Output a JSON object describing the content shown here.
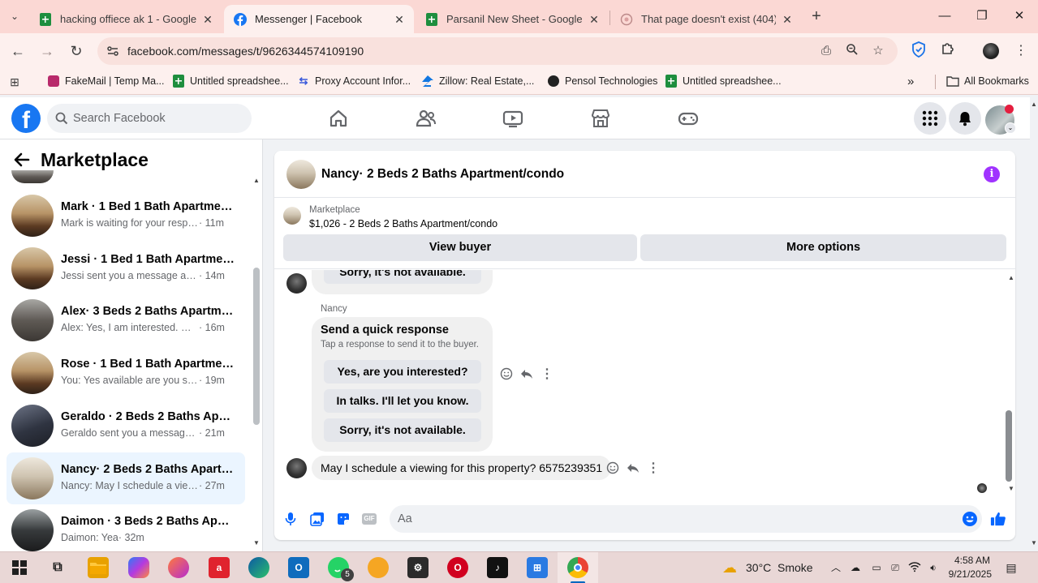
{
  "browser": {
    "tabs": [
      {
        "title": "hacking offiece ak 1 - Google Sh",
        "icon": "sheets-icon"
      },
      {
        "title": "Messenger | Facebook",
        "icon": "facebook-icon"
      },
      {
        "title": "Parsanil New Sheet - Google Sh",
        "icon": "sheets-icon"
      },
      {
        "title": "That page doesn't exist (404) - I",
        "icon": "globe-icon"
      }
    ],
    "active_tab": 1,
    "url": "facebook.com/messages/t/9626344574109190",
    "bookmarks": [
      {
        "label": "FakeMail | Temp Ma...",
        "icon": "fakemail-icon"
      },
      {
        "label": "Untitled spreadshee...",
        "icon": "sheets-icon"
      },
      {
        "label": "Proxy Account Infor...",
        "icon": "proxy-icon"
      },
      {
        "label": "Zillow: Real Estate,...",
        "icon": "zillow-icon"
      },
      {
        "label": "Pensol Technologies",
        "icon": "pensol-icon"
      },
      {
        "label": "Untitled spreadshee...",
        "icon": "sheets-icon"
      }
    ],
    "all_bookmarks": "All Bookmarks"
  },
  "facebook": {
    "search_placeholder": "Search Facebook",
    "brand_color": "#1877f2"
  },
  "sidebar": {
    "title": "Marketplace",
    "conversations": [
      {
        "name": "Mark · 1 Bed 1 Bath Apartment/...",
        "snippet": "Mark is waiting for your response.",
        "time": " · 11m",
        "active": false
      },
      {
        "name": "Jessi · 1 Bed 1 Bath Apartment/c...",
        "snippet": "Jessi sent you a message about y...",
        "time": " · 14m",
        "active": false
      },
      {
        "name": "Alex· 3 Beds 2 Baths Apartment...",
        "snippet": "Alex: Yes, I am interested. My nu...",
        "time": " · 16m",
        "active": false
      },
      {
        "name": "Rose · 1 Bed 1 Bath Apartment/c...",
        "snippet": "You: Yes available are you still int...",
        "time": " · 19m",
        "active": false
      },
      {
        "name": "Geraldo · 2 Beds 2 Baths Apart...",
        "snippet": "Geraldo sent you a message abo...",
        "time": " · 21m",
        "active": false
      },
      {
        "name": "Nancy· 2 Beds 2 Baths Apartme...",
        "snippet": "Nancy: May I schedule a viewing ...",
        "time": " · 27m",
        "active": true
      },
      {
        "name": "Daimon · 3 Beds 2 Baths Apart...",
        "snippet": "Daimon: Yea",
        "time": " · 32m",
        "active": false
      }
    ]
  },
  "chat": {
    "title": "Nancy· 2 Beds 2 Baths Apartment/condo",
    "marketplace_label": "Marketplace",
    "listing": "$1,026 - 2 Beds 2 Baths Apartment/condo",
    "view_buyer": "View buyer",
    "more_options": "More options",
    "top_partial_option": "Sorry, it's not available.",
    "sender_name": "Nancy",
    "quick_title": "Send a quick response",
    "quick_sub": "Tap a response to send it to the buyer.",
    "quick_options": [
      "Yes, are you interested?",
      "In talks. I'll let you know.",
      "Sorry, it's not available."
    ],
    "last_message": "May I schedule a viewing for this property? 6575239351",
    "composer_placeholder": "Aa",
    "accent_color": "#0866ff",
    "info_color": "#a033ff"
  },
  "taskbar": {
    "weather_temp": "30°C",
    "weather_desc": "Smoke",
    "time": "4:58 AM",
    "date": "9/21/2025",
    "whatsapp_badge": "5"
  }
}
